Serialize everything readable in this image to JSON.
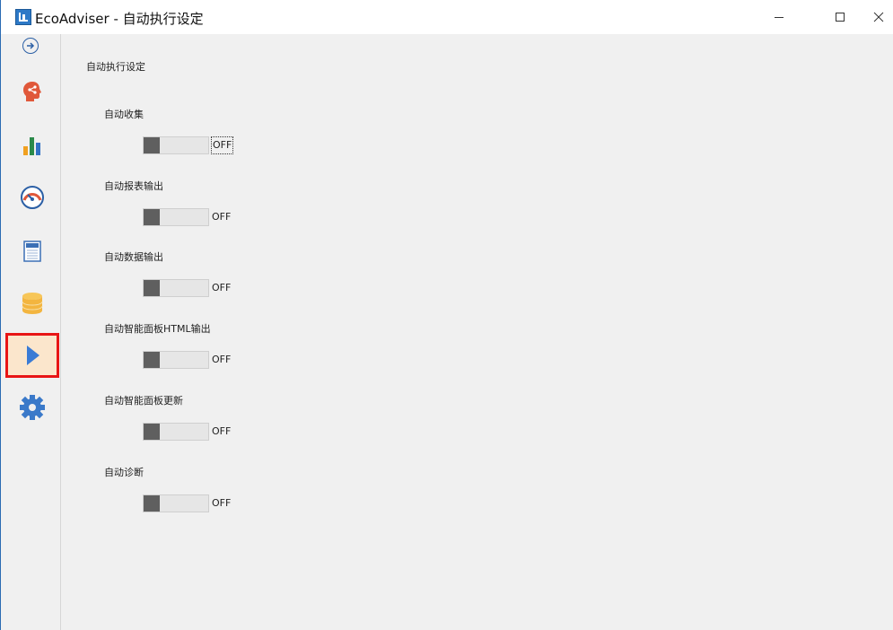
{
  "window": {
    "title": "EcoAdviser - 自动执行设定",
    "accent_color": "#2b6bb3"
  },
  "sidebar": {
    "items": [
      {
        "icon": "collapse-arrow-icon",
        "active": false
      },
      {
        "icon": "share-head-icon",
        "color": "#e0583a",
        "active": false
      },
      {
        "icon": "bar-chart-icon",
        "colors": [
          "#f0a020",
          "#2b8a4a",
          "#3373c4"
        ],
        "active": false
      },
      {
        "icon": "gauge-icon",
        "color": "#2b5fa5",
        "active": false
      },
      {
        "icon": "report-icon",
        "color": "#3b6fb5",
        "active": false
      },
      {
        "icon": "database-icon",
        "color": "#f3b53f",
        "active": false
      },
      {
        "icon": "play-icon",
        "color": "#3a7bd5",
        "active": true
      },
      {
        "icon": "gear-icon",
        "color": "#3a79c9",
        "active": false
      }
    ],
    "active_highlight_color": "#e81515"
  },
  "main": {
    "title": "自动执行设定",
    "settings": [
      {
        "label": "自动收集",
        "state": "OFF"
      },
      {
        "label": "自动报表输出",
        "state": "OFF"
      },
      {
        "label": "自动数据输出",
        "state": "OFF"
      },
      {
        "label": "自动智能面板HTML输出",
        "state": "OFF"
      },
      {
        "label": "自动智能面板更新",
        "state": "OFF"
      },
      {
        "label": "自动诊断",
        "state": "OFF"
      }
    ]
  }
}
